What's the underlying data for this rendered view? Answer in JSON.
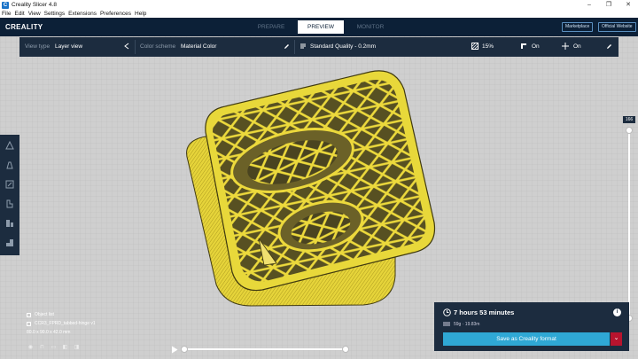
{
  "window": {
    "title": "Creality Slicer 4.8",
    "app_icon": "C"
  },
  "menu": [
    "File",
    "Edit",
    "View",
    "Settings",
    "Extensions",
    "Preferences",
    "Help"
  ],
  "header": {
    "brand": "CREALITY",
    "tabs": [
      {
        "label": "PREPARE",
        "active": false
      },
      {
        "label": "PREVIEW",
        "active": true
      },
      {
        "label": "MONITOR",
        "active": false
      }
    ],
    "marketplace": "Marketplace",
    "official_website": "Official Website"
  },
  "settings_bar": {
    "view_type_label": "View type",
    "view_type_value": "Layer view",
    "color_scheme_label": "Color scheme",
    "color_scheme_value": "Material Color",
    "profile": "Standard Quality - 0.2mm",
    "infill": "15%",
    "support": "On",
    "adhesion": "On"
  },
  "layer_slider": {
    "current_layer": "166",
    "level_fraction": 1.0
  },
  "object_info": {
    "object_list": "Object list",
    "filename": "CCR3_FPRD_tabbed-hinge v1",
    "dimensions": "80.0 x 90.0 x 42.0 mm"
  },
  "print_panel": {
    "time": "7 hours 53 minutes",
    "material": "59g · 19.83m",
    "save_button": "Save as Creality format"
  },
  "colors": {
    "accent": "#2fa8d5",
    "header_bg": "#0c2037",
    "panel_bg": "#1c2c3f",
    "model_yellow": "#e8d83a",
    "dropdown_red": "#b8142e"
  }
}
